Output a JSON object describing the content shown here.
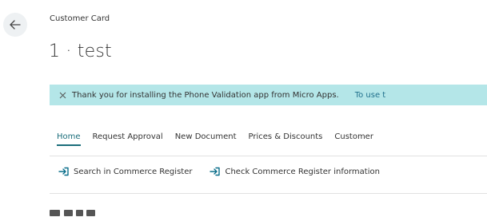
{
  "header": {
    "caption": "Customer Card",
    "title": "1 · test",
    "back_icon": "arrow-left-icon"
  },
  "notification": {
    "message": "Thank you for installing the Phone Validation app from Micro Apps.",
    "link_text": "To use t",
    "close_icon": "close-icon",
    "background": "#b4e6e8"
  },
  "action_tabs": [
    {
      "label": "Home",
      "active": true
    },
    {
      "label": "Request Approval",
      "active": false
    },
    {
      "label": "New Document",
      "active": false
    },
    {
      "label": "Prices & Discounts",
      "active": false
    },
    {
      "label": "Customer",
      "active": false
    }
  ],
  "actions": [
    {
      "label": "Search in Commerce Register",
      "icon": "arrow-right-enter-icon"
    },
    {
      "label": "Check Commerce Register information",
      "icon": "arrow-right-enter-icon"
    }
  ],
  "colors": {
    "accent": "#1a6d7a",
    "action_icon": "#0a6e8a"
  }
}
